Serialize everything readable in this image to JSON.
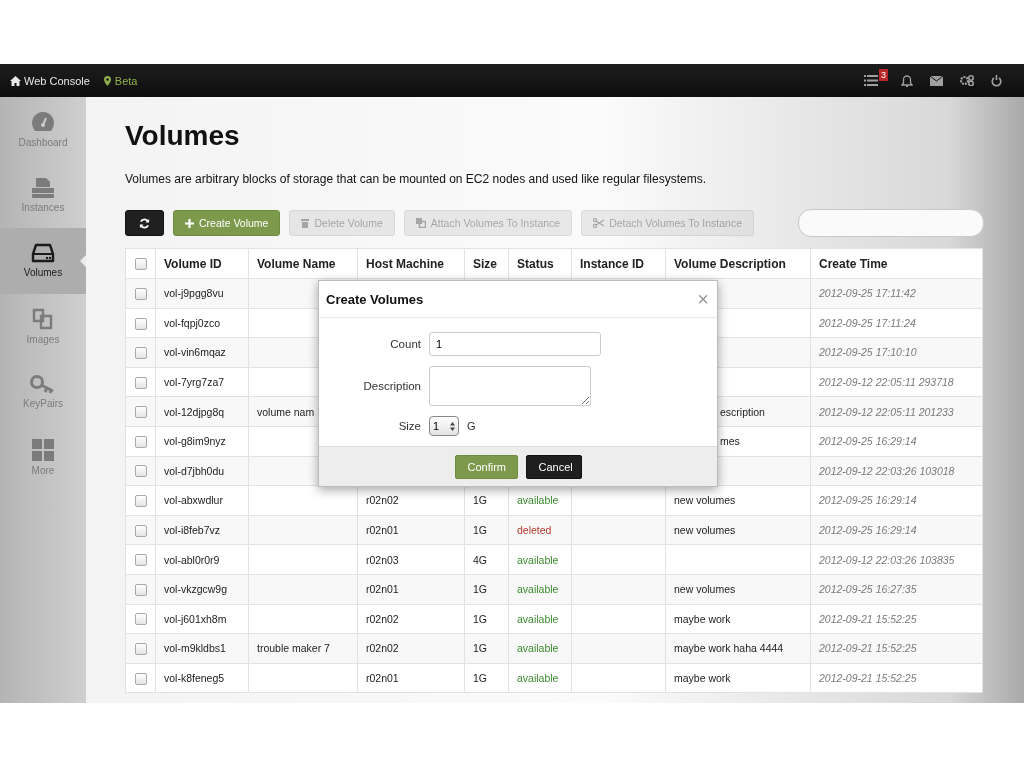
{
  "topbar": {
    "brand": "Web Console",
    "environment": "Beta",
    "task_count": "3"
  },
  "sidebar": {
    "items": [
      {
        "kind": "dashboard",
        "label": "Dashboard",
        "selected": false
      },
      {
        "kind": "instances",
        "label": "Instances",
        "selected": false
      },
      {
        "kind": "volumes",
        "label": "Volumes",
        "selected": true
      },
      {
        "kind": "images",
        "label": "Images",
        "selected": false
      },
      {
        "kind": "keypairs",
        "label": "KeyPairs",
        "selected": false
      },
      {
        "kind": "more",
        "label": "More",
        "selected": false
      }
    ]
  },
  "page": {
    "title": "Volumes",
    "description": "Volumes are arbitrary blocks of storage that can be mounted on EC2 nodes and used like regular filesystems."
  },
  "toolbar": {
    "buttons": [
      {
        "kind": "refresh",
        "disabled": false
      },
      {
        "kind": "create",
        "label": "Create Volume",
        "disabled": false
      },
      {
        "kind": "delete",
        "label": "Delete Volume",
        "disabled": true
      },
      {
        "kind": "attach",
        "label": "Attach Volumes To Instance",
        "disabled": true
      },
      {
        "kind": "detach",
        "label": "Detach Volumes To Instance",
        "disabled": true
      }
    ]
  },
  "table": {
    "select_all_checked": false,
    "columns": [
      "Volume ID",
      "Volume Name",
      "Host Machine",
      "Size",
      "Status",
      "Instance ID",
      "Volume Description",
      "Create Time"
    ],
    "rows": [
      {
        "checked": false,
        "id": "vol-j9pgg8vu",
        "time": "2012-09-25 17:11:42"
      },
      {
        "checked": false,
        "id": "vol-fqpj0zco",
        "time": "2012-09-25 17:11:24"
      },
      {
        "checked": false,
        "id": "vol-vin6mqaz",
        "time": "2012-09-25 17:10:10"
      },
      {
        "checked": false,
        "id": "vol-7yrg7za7",
        "time": "2012-09-12 22:05:11 293718"
      },
      {
        "checked": false,
        "id": "vol-12djpg8q",
        "name": "volume nam",
        "description": "escription",
        "description_clipped": true,
        "time": "2012-09-12 22:05:11 201233"
      },
      {
        "checked": false,
        "id": "vol-g8im9nyz",
        "description": "mes",
        "description_clipped": true,
        "time": "2012-09-25 16:29:14"
      },
      {
        "checked": false,
        "id": "vol-d7jbh0du",
        "time": "2012-09-12 22:03:26 103018"
      },
      {
        "checked": false,
        "id": "vol-abxwdlur",
        "host": "r02n02",
        "size": "1G",
        "status": {
          "text": "available",
          "color": "#3a8a2e"
        },
        "description": "new volumes",
        "time": "2012-09-25 16:29:14"
      },
      {
        "checked": false,
        "id": "vol-i8feb7vz",
        "host": "r02n01",
        "size": "1G",
        "status": {
          "text": "deleted",
          "color": "#b83a2e"
        },
        "description": "new volumes",
        "time": "2012-09-25 16:29:14"
      },
      {
        "checked": false,
        "id": "vol-abl0r0r9",
        "host": "r02n03",
        "size": "4G",
        "status": {
          "text": "available",
          "color": "#3a8a2e"
        },
        "time": "2012-09-12 22:03:26 103835"
      },
      {
        "checked": false,
        "id": "vol-vkzgcw9g",
        "host": "r02n01",
        "size": "1G",
        "status": {
          "text": "available",
          "color": "#3a8a2e"
        },
        "description": "new volumes",
        "time": "2012-09-25 16:27:35"
      },
      {
        "checked": false,
        "id": "vol-j601xh8m",
        "host": "r02n02",
        "size": "1G",
        "status": {
          "text": "available",
          "color": "#3a8a2e"
        },
        "description": "maybe work",
        "time": "2012-09-21 15:52:25"
      },
      {
        "checked": false,
        "id": "vol-m9kldbs1",
        "name": "trouble maker 7",
        "host": "r02n02",
        "size": "1G",
        "status": {
          "text": "available",
          "color": "#3a8a2e"
        },
        "description": "maybe work haha 4444",
        "time": "2012-09-21 15:52:25"
      },
      {
        "checked": false,
        "id": "vol-k8feneg5",
        "host": "r02n01",
        "size": "1G",
        "status": {
          "text": "available",
          "color": "#3a8a2e"
        },
        "description": "maybe work",
        "time": "2012-09-21 15:52:25"
      }
    ]
  },
  "dialog": {
    "title": "Create Volumes",
    "close": "×",
    "fields": [
      {
        "kind": "input",
        "label": "Count",
        "value": "1"
      },
      {
        "kind": "textarea",
        "label": "Description"
      },
      {
        "kind": "select",
        "label": "Size",
        "value": "1",
        "unit": "G"
      }
    ],
    "buttons": [
      {
        "kind": "primary",
        "label": "Confirm"
      },
      {
        "kind": "dark",
        "label": "Cancel"
      }
    ]
  }
}
